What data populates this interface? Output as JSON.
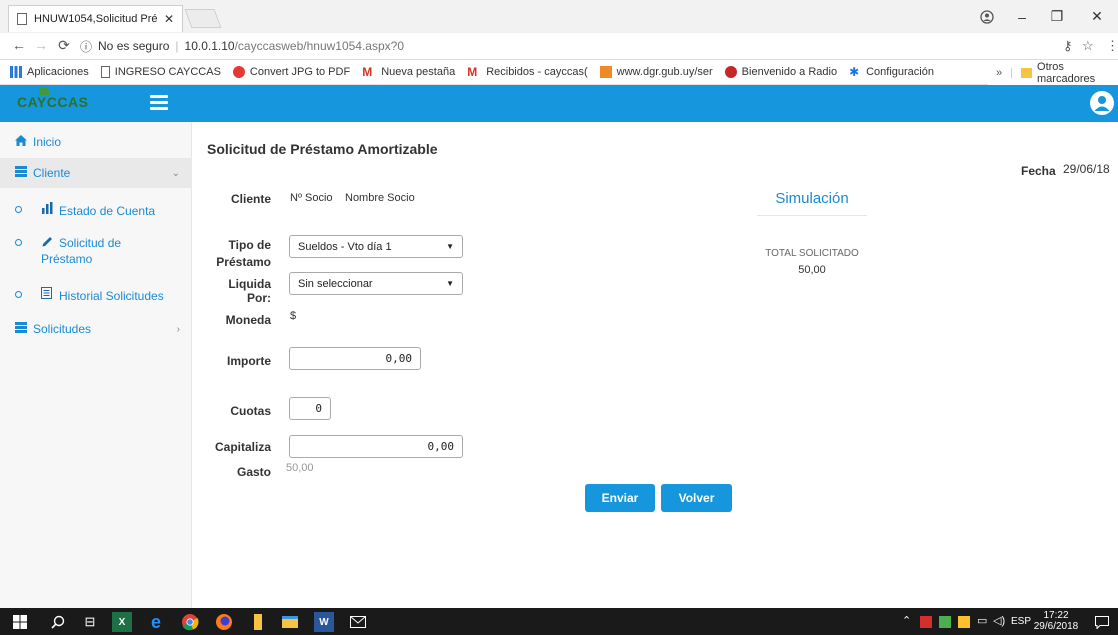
{
  "browser": {
    "tab_title": "HNUW1054,Solicitud Pré",
    "security_label": "No es seguro",
    "url_host": "10.0.1.10",
    "url_path": "/cayccasweb/hnuw1054.aspx?0"
  },
  "bookmarks": {
    "items": [
      "Aplicaciones",
      "INGRESO CAYCCAS",
      "Convert JPG to PDF",
      "Nueva pestaña",
      "Recibidos - cayccas(",
      "www.dgr.gub.uy/ser",
      "Bienvenido a Radio",
      "Configuración"
    ],
    "overflow": "»",
    "others": "Otros marcadores"
  },
  "app": {
    "logo_text": "CAYCCAS",
    "header_color": "#1697dd"
  },
  "sidebar": {
    "inicio": "Inicio",
    "cliente": "Cliente",
    "sub": [
      "Estado de Cuenta",
      "Solicitud de",
      "Préstamo",
      "Historial Solicitudes"
    ],
    "solicitudes": "Solicitudes"
  },
  "form": {
    "title": "Solicitud de Préstamo Amortizable",
    "fecha_label": "Fecha",
    "fecha_value": "29/06/18",
    "cliente_label": "Cliente",
    "nro_socio": "Nº Socio",
    "nombre_socio": "Nombre Socio",
    "tipo_label_1": "Tipo de",
    "tipo_label_2": "Préstamo",
    "tipo_value": "Sueldos - Vto día 1",
    "liquida_label": "Liquida Por:",
    "liquida_value": "Sin seleccionar",
    "moneda_label": "Moneda",
    "moneda_value": "$",
    "importe_label": "Importe",
    "importe_value": "0,00",
    "cuotas_label": "Cuotas",
    "cuotas_value": "0",
    "capitaliza_label": "Capitaliza",
    "capitaliza_value": "0,00",
    "gasto_label": "Gasto",
    "gasto_value": "50,00",
    "enviar": "Enviar",
    "volver": "Volver"
  },
  "simulation": {
    "title": "Simulación",
    "total_label": "TOTAL SOLICITADO",
    "total_value": "50,00"
  },
  "taskbar": {
    "lang": "ESP",
    "time": "17:22",
    "date": "29/6/2018"
  }
}
